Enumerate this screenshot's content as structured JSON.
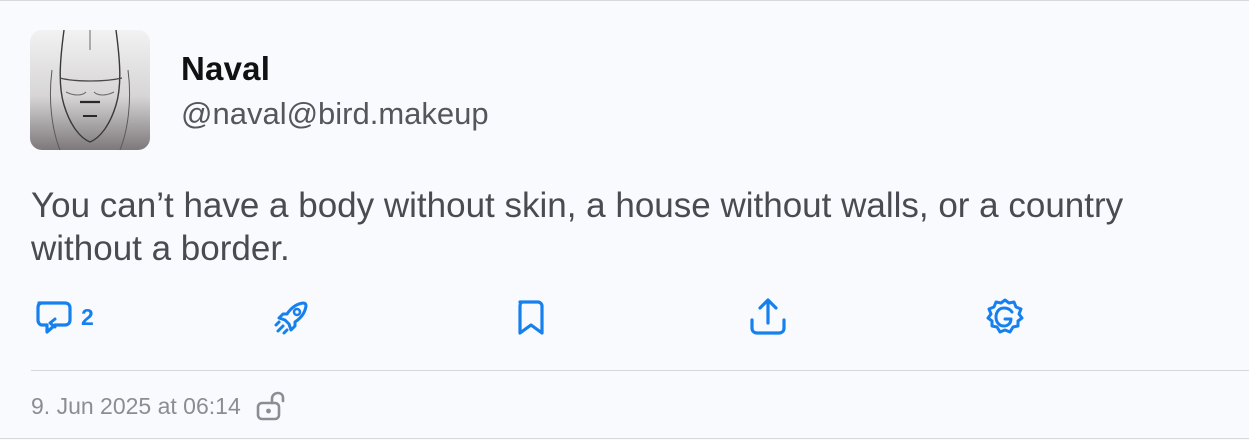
{
  "post": {
    "author": {
      "display_name": "Naval",
      "handle": "@naval@bird.makeup",
      "avatar_icon": "sketched-face-avatar"
    },
    "text": "You can’t have a body without skin, a house without walls, or a country without a border.",
    "actions": {
      "reply": {
        "icon": "reply-bubble-icon",
        "count": "2"
      },
      "boost": {
        "icon": "rocket-icon"
      },
      "bookmark": {
        "icon": "bookmark-icon"
      },
      "share": {
        "icon": "share-icon"
      },
      "translate": {
        "icon": "gear-translate-icon"
      }
    },
    "timestamp": "9. Jun 2025 at 06:14",
    "visibility_icon": "unlocked-icon"
  },
  "colors": {
    "accent": "#1580ee",
    "background": "#f9fafe",
    "text": "#4a4b52",
    "meta": "#8c8d93"
  }
}
